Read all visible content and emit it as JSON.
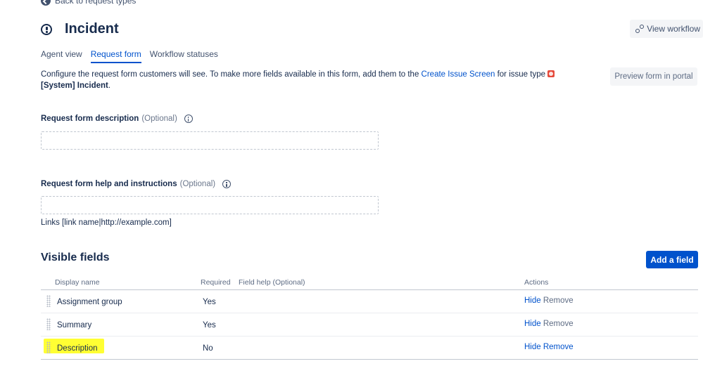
{
  "nav": {
    "back_label": "Back to request types"
  },
  "header": {
    "title": "Incident",
    "view_workflow_label": "View workflow"
  },
  "tabs": [
    {
      "label": "Agent view",
      "active": false
    },
    {
      "label": "Request form",
      "active": true
    },
    {
      "label": "Workflow statuses",
      "active": false
    }
  ],
  "intro": {
    "text_before": "Configure the request form customers will see. To make more fields available in this form, add them to the ",
    "link": "Create Issue Screen",
    "text_after": " for issue type ",
    "issue_type_bold": "[System] Incident",
    "end": "."
  },
  "preview_label": "Preview form in portal",
  "form": {
    "description_label": "Request form description",
    "help_label": "Request form help and instructions",
    "optional": "(Optional)",
    "links_hint": "Links [link name|http://example.com]"
  },
  "visible_fields": {
    "title": "Visible fields",
    "add_label": "Add a field",
    "columns": {
      "display_name": "Display name",
      "required": "Required",
      "field_help": "Field help",
      "field_help_optional": "(Optional)",
      "actions": "Actions"
    },
    "rows": [
      {
        "name": "Assignment group",
        "required": "Yes",
        "hide": "Hide",
        "remove": "Remove"
      },
      {
        "name": "Summary",
        "required": "Yes",
        "hide": "Hide",
        "remove": "Remove"
      },
      {
        "name": "Description",
        "required": "No",
        "hide": "Hide",
        "remove": "Remove"
      }
    ]
  },
  "colors": {
    "primary": "#0052cc",
    "text": "#172b4d",
    "subtle": "#5e6c84",
    "highlight": "#ffff33",
    "issue_type_red": "#e5493a"
  },
  "icons": {
    "back": "arrow-left-circle-icon",
    "issue": "exclamation-circle-icon",
    "workflow": "workflow-icon",
    "info": "info-icon",
    "drag": "drag-handle-icon"
  }
}
